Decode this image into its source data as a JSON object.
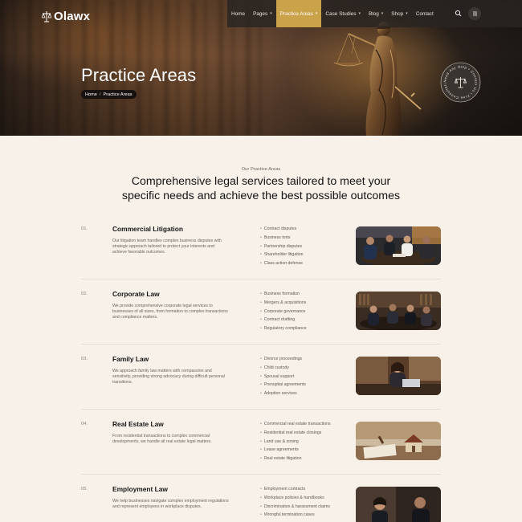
{
  "brand": {
    "name": "Olawx",
    "accent": "#c9a24a"
  },
  "nav": {
    "items": [
      {
        "label": "Home",
        "dropdown": false,
        "active": false
      },
      {
        "label": "Pages",
        "dropdown": true,
        "active": false
      },
      {
        "label": "Practice Areas",
        "dropdown": true,
        "active": true
      },
      {
        "label": "Case Studies",
        "dropdown": true,
        "active": false
      },
      {
        "label": "Blog",
        "dropdown": true,
        "active": false
      },
      {
        "label": "Shop",
        "dropdown": true,
        "active": false
      },
      {
        "label": "Contact",
        "dropdown": false,
        "active": false
      }
    ],
    "icons": [
      "search-icon",
      "menu-icon"
    ]
  },
  "hero": {
    "title": "Practice Areas",
    "breadcrumb": {
      "home": "Home",
      "separator": "/",
      "current": "Practice Areas"
    },
    "badge_text": "Need Any Help • Contact Us • Free Consultation •"
  },
  "intro": {
    "eyebrow": "Our Practice Areas",
    "heading_line1": "Comprehensive legal services tailored to meet your",
    "heading_line2": "specific needs and achieve the best possible outcomes"
  },
  "practices": [
    {
      "number": "01.",
      "title": "Commercial Litigation",
      "description": "Our litigation team handles complex business disputes with strategic approach tailored to protect your interests and achieve favorable outcomes.",
      "bullets": [
        "Contract disputes",
        "Business torts",
        "Partnership disputes",
        "Shareholder litigation",
        "Class action defense"
      ]
    },
    {
      "number": "02.",
      "title": "Corporate Law",
      "description": "We provide comprehensive corporate legal services to businesses of all sizes, from formation to complex transactions and compliance matters.",
      "bullets": [
        "Business formation",
        "Mergers & acquisitions",
        "Corporate governance",
        "Contract drafting",
        "Regulatory compliance"
      ]
    },
    {
      "number": "03.",
      "title": "Family Law",
      "description": "We approach family law matters with compassion and sensitivity, providing strong advocacy during difficult personal transitions.",
      "bullets": [
        "Divorce proceedings",
        "Child custody",
        "Spousal support",
        "Prenuptial agreements",
        "Adoption services"
      ]
    },
    {
      "number": "04.",
      "title": "Real Estate Law",
      "description": "From residential transactions to complex commercial developments, we handle all real estate legal matters.",
      "bullets": [
        "Commercial real estate transactions",
        "Residential real estate closings",
        "Land use & zoning",
        "Lease agreements",
        "Real estate litigation"
      ]
    },
    {
      "number": "05.",
      "title": "Employment Law",
      "description": "We help businesses navigate complex employment regulations and represent employees in workplace disputes.",
      "bullets": [
        "Employment contracts",
        "Workplace policies & handbooks",
        "Discrimination & harassment claims",
        "Wrongful termination cases"
      ]
    }
  ]
}
